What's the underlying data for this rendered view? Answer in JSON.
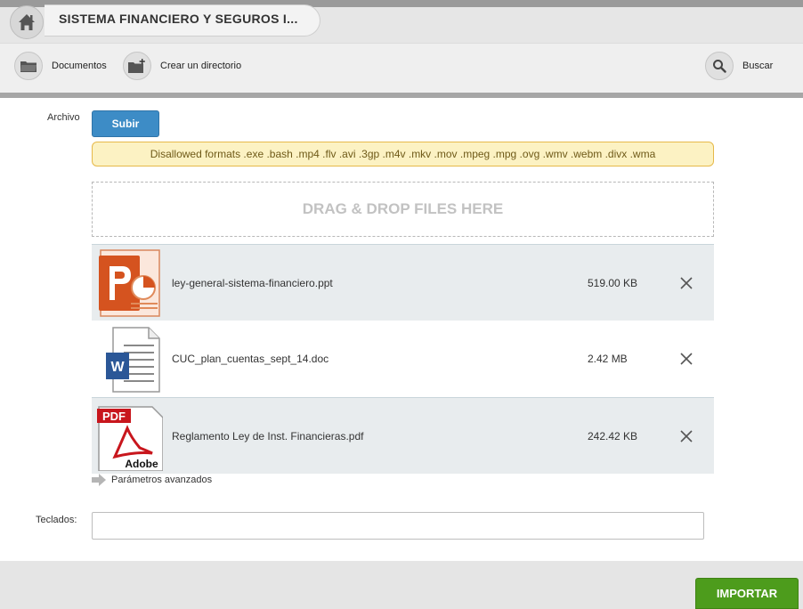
{
  "header": {
    "title": "SISTEMA FINANCIERO Y SEGUROS I...",
    "home_icon": "home-icon"
  },
  "toolbar": {
    "documents_label": "Documentos",
    "create_dir_label": "Crear un directorio",
    "search_label": "Buscar"
  },
  "form": {
    "archivo_label": "Archivo",
    "upload_label": "Subir",
    "disallowed_formats": "Disallowed formats .exe .bash .mp4 .flv .avi .3gp .m4v .mkv .mov .mpeg .mpg .ovg .wmv .webm .divx .wma",
    "dropzone_text": "DRAG & DROP FILES HERE",
    "files": [
      {
        "name": "ley-general-sistema-financiero.ppt",
        "size": "519.00 KB",
        "icon": "powerpoint-file-icon"
      },
      {
        "name": "CUC_plan_cuentas_sept_14.doc",
        "size": "2.42 MB",
        "icon": "word-file-icon"
      },
      {
        "name": "Reglamento Ley de Inst. Financieras.pdf",
        "size": "242.42 KB",
        "icon": "pdf-file-icon",
        "icon_text_top": "PDF",
        "icon_text_bottom": "Adobe"
      }
    ],
    "advanced_label": "Parámetros avanzados",
    "tags_label": "Teclados:",
    "tags_value": "",
    "import_label": "IMPORTAR"
  },
  "colors": {
    "upload_button": "#3d8cc6",
    "import_button": "#4d9c1c",
    "warning_bg": "#fcf2c3",
    "warning_border": "#e6b94a"
  }
}
